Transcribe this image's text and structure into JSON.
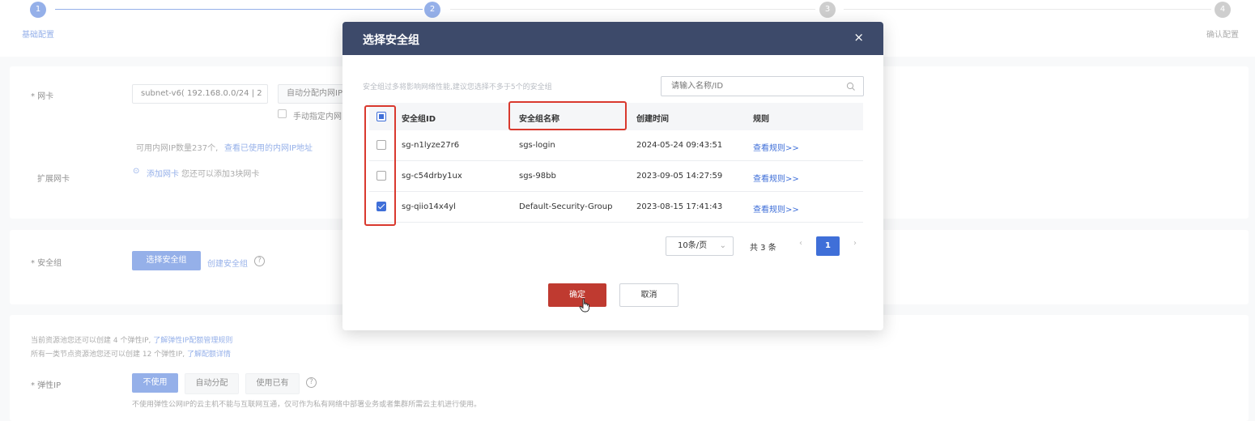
{
  "steps": [
    {
      "num": "1",
      "label": "基础配置"
    },
    {
      "num": "2",
      "label": ""
    },
    {
      "num": "3",
      "label": ""
    },
    {
      "num": "4",
      "label": "确认配置"
    }
  ],
  "nic_section": {
    "nic_label": "* 网卡",
    "subnet_value": "subnet-v6( 192.168.0.0/24 | 2",
    "ip_mode_value": "自动分配内网IP",
    "manual_ip_label": "手动指定内网",
    "ip_count_text": "可用内网IP数量237个,",
    "view_used_ip_link": "查看已使用的内网IP地址",
    "ext_nic_label": "扩展网卡",
    "add_nic_link": "添加网卡",
    "add_nic_hint": "您还可以添加3块网卡"
  },
  "sg_section": {
    "label": "* 安全组",
    "select_button": "选择安全组",
    "create_link": "创建安全组"
  },
  "eip_section": {
    "quota_line1": "当前资源池您还可以创建 4 个弹性IP,",
    "quota_link1": "了解弹性IP配额管理规则",
    "quota_line2": "所有一类节点资源池您还可以创建 12 个弹性IP,",
    "quota_link2": "了解配额详情",
    "label": "* 弹性IP",
    "options": [
      "不使用",
      "自动分配",
      "使用已有"
    ],
    "note": "不使用弹性公网IP的云主机不能与互联网互通，仅可作为私有网络中部署业务或者集群所需云主机进行使用。"
  },
  "modal": {
    "title": "选择安全组",
    "close_glyph": "×",
    "hint": "安全组过多将影响网络性能,建议您选择不多于5个的安全组",
    "search_placeholder": "请输入名称/ID",
    "columns": [
      "安全组ID",
      "安全组名称",
      "创建时间",
      "规则"
    ],
    "rows": [
      {
        "id": "sg-n1lyze27r6",
        "name": "sgs-login",
        "created": "2024-05-24 09:43:51",
        "rule_link": "查看规则>>",
        "checked": false
      },
      {
        "id": "sg-c54drby1ux",
        "name": "sgs-98bb",
        "created": "2023-09-05 14:27:59",
        "rule_link": "查看规则>>",
        "checked": false
      },
      {
        "id": "sg-qiio14x4yl",
        "name": "Default-Security-Group",
        "created": "2023-08-15 17:41:43",
        "rule_link": "查看规则>>",
        "checked": true
      }
    ],
    "pager": {
      "page_size": "10条/页",
      "total": "共 3 条",
      "prev": "‹",
      "next": "›",
      "current_page": "1"
    },
    "confirm_label": "确定",
    "cancel_label": "取消"
  },
  "colors": {
    "primary": "#3f6fd8",
    "header": "#3d4a6a",
    "confirm": "#bf3a30",
    "highlight": "#d9392e"
  }
}
